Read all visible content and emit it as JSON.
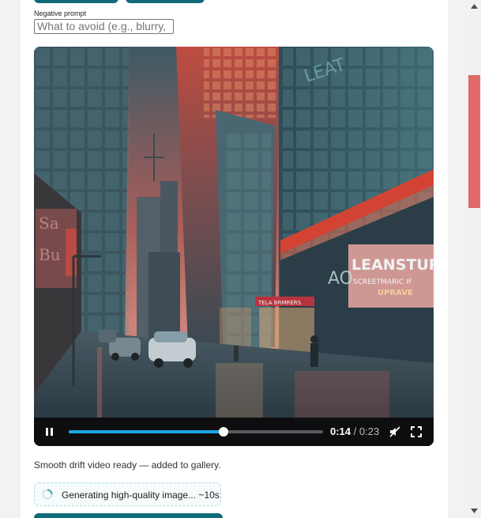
{
  "form": {
    "negative_prompt_label": "Negative prompt",
    "negative_prompt_placeholder": "What to avoid (e.g., blurry,",
    "negative_prompt_value": ""
  },
  "video": {
    "scene_signs": {
      "top_sign": "LEAT",
      "main_sign": "LEANSTUR",
      "sub_sign": "SCREETMARIC IF",
      "sub_sign_2": "UPRAVE",
      "shop_sign": "TELA BRMRERS",
      "ao_sign": "AO"
    },
    "time_current": "0:14",
    "time_separator": " / ",
    "time_total": "0:23",
    "progress": 0.61,
    "state": "playing",
    "muted": true
  },
  "status": {
    "message": "Smooth drift video ready — added to gallery."
  },
  "generating": {
    "text": "Generating high-quality image... ~10s"
  },
  "colors": {
    "accent": "#0f6b78",
    "progress": "#1aa6e8",
    "scroll_thumb": "#e06a6a"
  },
  "icons": {
    "play_pause": "pause-icon",
    "mute": "volume-muted-icon",
    "fullscreen": "fullscreen-icon",
    "spinner": "spinner-icon"
  }
}
